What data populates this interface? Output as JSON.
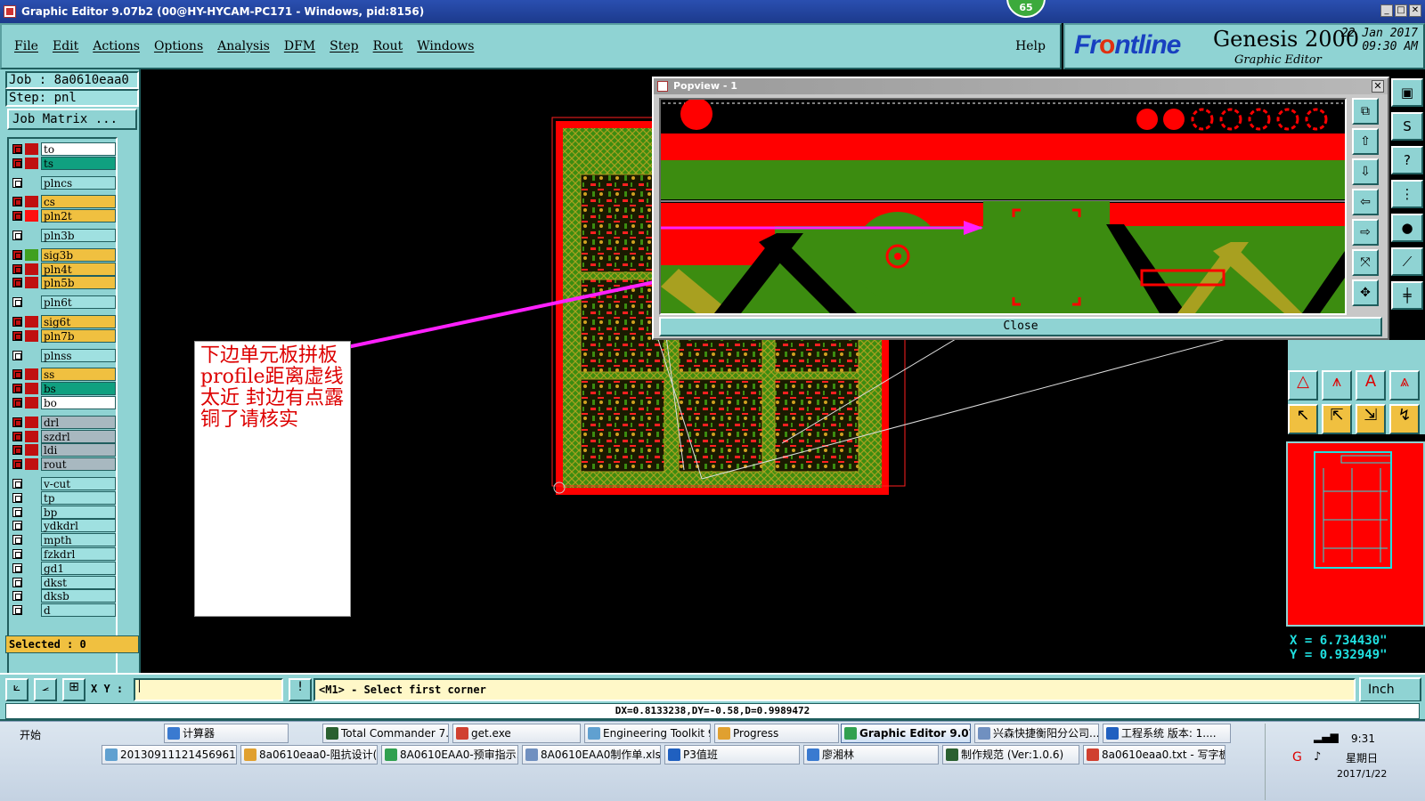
{
  "window": {
    "title": "Graphic Editor 9.07b2 (00@HY-HYCAM-PC171 - Windows, pid:8156)",
    "badge": "65"
  },
  "menu": {
    "items": [
      "File",
      "Edit",
      "Actions",
      "Options",
      "Analysis",
      "DFM",
      "Step",
      "Rout",
      "Windows"
    ],
    "help": "Help"
  },
  "logo": {
    "brand_pre": "Fr",
    "brand_o": "o",
    "brand_post": "ntline",
    "product": "Genesis 2000",
    "sub": "Graphic Editor",
    "date": "22 Jan 2017",
    "time": "09:30 AM"
  },
  "job": {
    "job_line": "Job : 8a0610eaa0",
    "step_line": "Step: pnl",
    "matrix_button": "Job Matrix ..."
  },
  "layers": [
    {
      "name": "to",
      "on": true,
      "color": "#ffffff",
      "swatch": "#c01010"
    },
    {
      "name": "ts",
      "on": true,
      "color": "#10a080",
      "swatch": "#c01010"
    },
    {
      "name": "plncs",
      "on": false,
      "color": "#9fe0e0",
      "swatch": ""
    },
    {
      "name": "cs",
      "on": true,
      "color": "#f0c040",
      "swatch": "#c01010"
    },
    {
      "name": "pln2t",
      "on": true,
      "color": "#f0c040",
      "swatch": "#ff1010"
    },
    {
      "name": "pln3b",
      "on": false,
      "color": "#9fe0e0",
      "swatch": ""
    },
    {
      "name": "sig3b",
      "on": true,
      "color": "#f0c040",
      "swatch": "#40a020"
    },
    {
      "name": "pln4t",
      "on": true,
      "color": "#f0c040",
      "swatch": "#c01010"
    },
    {
      "name": "pln5b",
      "on": true,
      "color": "#f0c040",
      "swatch": "#c01010"
    },
    {
      "name": "pln6t",
      "on": false,
      "color": "#9fe0e0",
      "swatch": ""
    },
    {
      "name": "sig6t",
      "on": true,
      "color": "#f0c040",
      "swatch": "#c01010"
    },
    {
      "name": "pln7b",
      "on": true,
      "color": "#f0c040",
      "swatch": "#c01010"
    },
    {
      "name": "plnss",
      "on": false,
      "color": "#9fe0e0",
      "swatch": ""
    },
    {
      "name": "ss",
      "on": true,
      "color": "#f0c040",
      "swatch": "#c01010"
    },
    {
      "name": "bs",
      "on": true,
      "color": "#10a080",
      "swatch": "#c01010"
    },
    {
      "name": "bo",
      "on": true,
      "color": "#ffffff",
      "swatch": "#c01010"
    },
    {
      "name": "drl",
      "on": true,
      "color": "#a8b8c0",
      "swatch": "#c01010"
    },
    {
      "name": "szdrl",
      "on": true,
      "color": "#a8b8c0",
      "swatch": "#c01010"
    },
    {
      "name": "ldi",
      "on": true,
      "color": "#a8b8c0",
      "swatch": "#c01010"
    },
    {
      "name": "rout",
      "on": true,
      "color": "#a8b8c0",
      "swatch": "#c01010"
    },
    {
      "name": "v-cut",
      "on": false,
      "color": "#9fe0e0",
      "swatch": ""
    },
    {
      "name": "tp",
      "on": false,
      "color": "#9fe0e0",
      "swatch": ""
    },
    {
      "name": "bp",
      "on": false,
      "color": "#9fe0e0",
      "swatch": ""
    },
    {
      "name": "ydkdrl",
      "on": false,
      "color": "#9fe0e0",
      "swatch": ""
    },
    {
      "name": "mpth",
      "on": false,
      "color": "#9fe0e0",
      "swatch": ""
    },
    {
      "name": "fzkdrl",
      "on": false,
      "color": "#9fe0e0",
      "swatch": ""
    },
    {
      "name": "gd1",
      "on": false,
      "color": "#9fe0e0",
      "swatch": ""
    },
    {
      "name": "dkst",
      "on": false,
      "color": "#9fe0e0",
      "swatch": ""
    },
    {
      "name": "dksb",
      "on": false,
      "color": "#9fe0e0",
      "swatch": ""
    },
    {
      "name": "d",
      "on": false,
      "color": "#9fe0e0",
      "swatch": ""
    }
  ],
  "selected": "Selected : 0",
  "annotation": "下边单元板拼板profile距离虚线太近 封边有点露铜了请核实",
  "popview": {
    "title": "Popview - 1",
    "close": "Close"
  },
  "coords": {
    "x": "X = 6.734430\"",
    "y": "Y = 0.932949\""
  },
  "command": {
    "xy_label": "X Y :",
    "prompt": "<M1> - Select first corner",
    "unit": "Inch"
  },
  "status": "DX=0.8133238,DY=-0.58,D=0.9989472",
  "taskbar": {
    "start": "开始",
    "row1": [
      "计算器",
      "Total Commander 7.0 ...",
      "get.exe",
      "Engineering Toolkit 9....",
      "Progress",
      "Graphic Editor 9.07...",
      "兴森快捷衡阳分公司...",
      "工程系统  版本: 1...."
    ],
    "row2": [
      "20130911121456961.rtf...",
      "8a0610eaa0-阻抗设计(...",
      "8A0610EAA0-预审指示....",
      "8A0610EAA0制作单.xls ...",
      "P3值班",
      "廖湘林",
      "制作规范 (Ver:1.0.6)",
      "8a0610eaa0.txt - 写字板"
    ],
    "clock_time": "9:31",
    "clock_day": "星期日",
    "clock_date": "2017/1/22"
  },
  "colors": {
    "panel": "#8fd3d3",
    "copper_red": "#ff0000",
    "mask_green": "#3c8c10",
    "annotation_arrow": "#ff20ff"
  }
}
